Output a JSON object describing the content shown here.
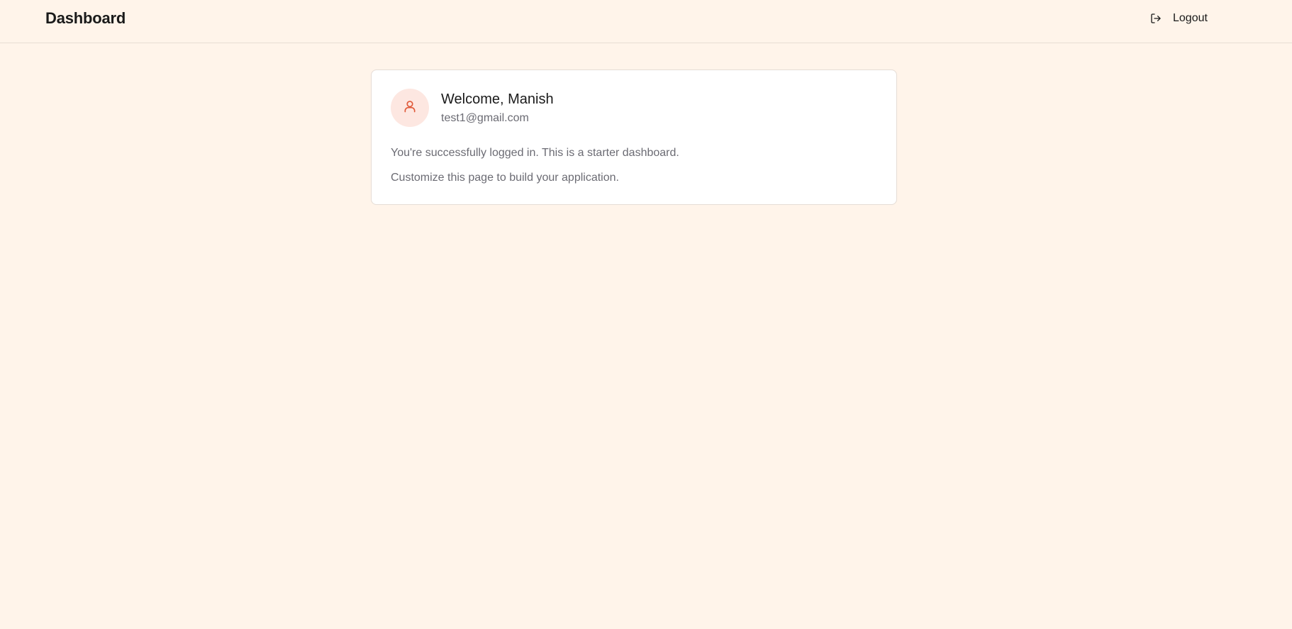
{
  "header": {
    "title": "Dashboard",
    "logout_label": "Logout",
    "logout_icon": "logout-icon"
  },
  "card": {
    "avatar_icon": "user-icon",
    "greeting": "Welcome, Manish",
    "email": "test1@gmail.com",
    "message_1": "You're successfully logged in. This is a starter dashboard.",
    "message_2": "Customize this page to build your application."
  },
  "colors": {
    "background": "#fff4ea",
    "accent": "#e05a3a",
    "avatar_bg": "#fde7e1",
    "muted_text": "#6b6b73"
  }
}
